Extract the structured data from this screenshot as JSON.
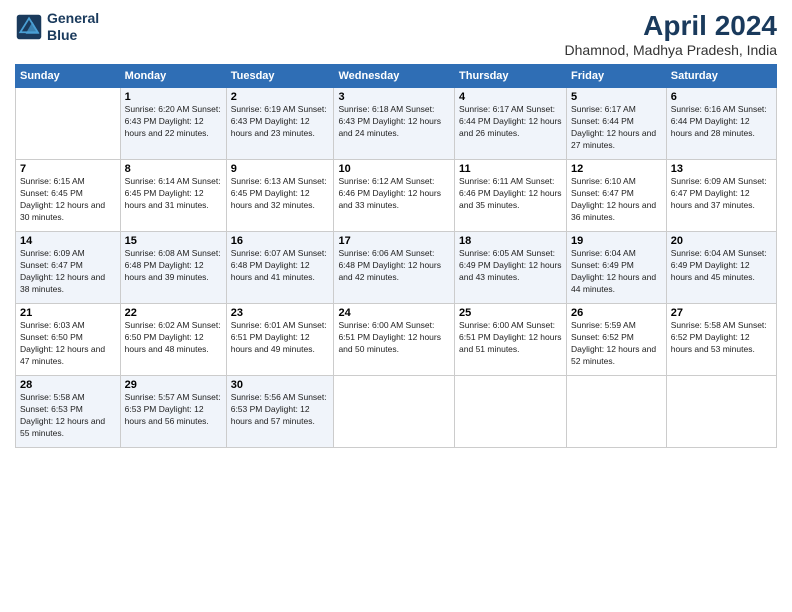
{
  "logo": {
    "line1": "General",
    "line2": "Blue"
  },
  "title": "April 2024",
  "subtitle": "Dhamnod, Madhya Pradesh, India",
  "days_of_week": [
    "Sunday",
    "Monday",
    "Tuesday",
    "Wednesday",
    "Thursday",
    "Friday",
    "Saturday"
  ],
  "weeks": [
    [
      {
        "day": "",
        "info": ""
      },
      {
        "day": "1",
        "info": "Sunrise: 6:20 AM\nSunset: 6:43 PM\nDaylight: 12 hours\nand 22 minutes."
      },
      {
        "day": "2",
        "info": "Sunrise: 6:19 AM\nSunset: 6:43 PM\nDaylight: 12 hours\nand 23 minutes."
      },
      {
        "day": "3",
        "info": "Sunrise: 6:18 AM\nSunset: 6:43 PM\nDaylight: 12 hours\nand 24 minutes."
      },
      {
        "day": "4",
        "info": "Sunrise: 6:17 AM\nSunset: 6:44 PM\nDaylight: 12 hours\nand 26 minutes."
      },
      {
        "day": "5",
        "info": "Sunrise: 6:17 AM\nSunset: 6:44 PM\nDaylight: 12 hours\nand 27 minutes."
      },
      {
        "day": "6",
        "info": "Sunrise: 6:16 AM\nSunset: 6:44 PM\nDaylight: 12 hours\nand 28 minutes."
      }
    ],
    [
      {
        "day": "7",
        "info": "Sunrise: 6:15 AM\nSunset: 6:45 PM\nDaylight: 12 hours\nand 30 minutes."
      },
      {
        "day": "8",
        "info": "Sunrise: 6:14 AM\nSunset: 6:45 PM\nDaylight: 12 hours\nand 31 minutes."
      },
      {
        "day": "9",
        "info": "Sunrise: 6:13 AM\nSunset: 6:45 PM\nDaylight: 12 hours\nand 32 minutes."
      },
      {
        "day": "10",
        "info": "Sunrise: 6:12 AM\nSunset: 6:46 PM\nDaylight: 12 hours\nand 33 minutes."
      },
      {
        "day": "11",
        "info": "Sunrise: 6:11 AM\nSunset: 6:46 PM\nDaylight: 12 hours\nand 35 minutes."
      },
      {
        "day": "12",
        "info": "Sunrise: 6:10 AM\nSunset: 6:47 PM\nDaylight: 12 hours\nand 36 minutes."
      },
      {
        "day": "13",
        "info": "Sunrise: 6:09 AM\nSunset: 6:47 PM\nDaylight: 12 hours\nand 37 minutes."
      }
    ],
    [
      {
        "day": "14",
        "info": "Sunrise: 6:09 AM\nSunset: 6:47 PM\nDaylight: 12 hours\nand 38 minutes."
      },
      {
        "day": "15",
        "info": "Sunrise: 6:08 AM\nSunset: 6:48 PM\nDaylight: 12 hours\nand 39 minutes."
      },
      {
        "day": "16",
        "info": "Sunrise: 6:07 AM\nSunset: 6:48 PM\nDaylight: 12 hours\nand 41 minutes."
      },
      {
        "day": "17",
        "info": "Sunrise: 6:06 AM\nSunset: 6:48 PM\nDaylight: 12 hours\nand 42 minutes."
      },
      {
        "day": "18",
        "info": "Sunrise: 6:05 AM\nSunset: 6:49 PM\nDaylight: 12 hours\nand 43 minutes."
      },
      {
        "day": "19",
        "info": "Sunrise: 6:04 AM\nSunset: 6:49 PM\nDaylight: 12 hours\nand 44 minutes."
      },
      {
        "day": "20",
        "info": "Sunrise: 6:04 AM\nSunset: 6:49 PM\nDaylight: 12 hours\nand 45 minutes."
      }
    ],
    [
      {
        "day": "21",
        "info": "Sunrise: 6:03 AM\nSunset: 6:50 PM\nDaylight: 12 hours\nand 47 minutes."
      },
      {
        "day": "22",
        "info": "Sunrise: 6:02 AM\nSunset: 6:50 PM\nDaylight: 12 hours\nand 48 minutes."
      },
      {
        "day": "23",
        "info": "Sunrise: 6:01 AM\nSunset: 6:51 PM\nDaylight: 12 hours\nand 49 minutes."
      },
      {
        "day": "24",
        "info": "Sunrise: 6:00 AM\nSunset: 6:51 PM\nDaylight: 12 hours\nand 50 minutes."
      },
      {
        "day": "25",
        "info": "Sunrise: 6:00 AM\nSunset: 6:51 PM\nDaylight: 12 hours\nand 51 minutes."
      },
      {
        "day": "26",
        "info": "Sunrise: 5:59 AM\nSunset: 6:52 PM\nDaylight: 12 hours\nand 52 minutes."
      },
      {
        "day": "27",
        "info": "Sunrise: 5:58 AM\nSunset: 6:52 PM\nDaylight: 12 hours\nand 53 minutes."
      }
    ],
    [
      {
        "day": "28",
        "info": "Sunrise: 5:58 AM\nSunset: 6:53 PM\nDaylight: 12 hours\nand 55 minutes."
      },
      {
        "day": "29",
        "info": "Sunrise: 5:57 AM\nSunset: 6:53 PM\nDaylight: 12 hours\nand 56 minutes."
      },
      {
        "day": "30",
        "info": "Sunrise: 5:56 AM\nSunset: 6:53 PM\nDaylight: 12 hours\nand 57 minutes."
      },
      {
        "day": "",
        "info": ""
      },
      {
        "day": "",
        "info": ""
      },
      {
        "day": "",
        "info": ""
      },
      {
        "day": "",
        "info": ""
      }
    ]
  ]
}
